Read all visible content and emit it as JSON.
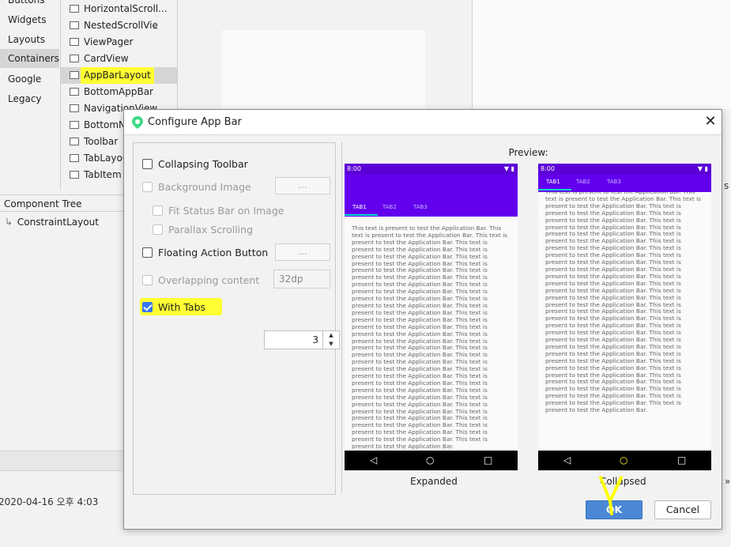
{
  "categories": [
    "Buttons",
    "Widgets",
    "Layouts",
    "Containers",
    "Google",
    "Legacy"
  ],
  "palette_items": [
    "HorizontalScroll...",
    "NestedScrollVie",
    "ViewPager",
    "CardView",
    "AppBarLayout",
    "BottomAppBar",
    "NavigationView",
    "BottomNa",
    "Toolbar",
    "TabLayout",
    "TabItem"
  ],
  "component_tree": {
    "header": "Component Tree",
    "root": "ConstraintLayout"
  },
  "timestamp": "2020-04-16 오후 4:03",
  "side_fragments": [
    "s",
    "»"
  ],
  "dialog": {
    "title": "Configure App Bar",
    "close": "✕",
    "options": {
      "collapsing_toolbar": "Collapsing Toolbar",
      "background_image": "Background Image",
      "fit_status_bar": "Fit Status Bar on Image",
      "parallax": "Parallax Scrolling",
      "fab": "Floating Action Button",
      "overlapping": "Overlapping content",
      "with_tabs": "With Tabs"
    },
    "browse": "...",
    "overlap_value": "32dp",
    "tabs_count": "3",
    "preview_label": "Preview:",
    "status_time": "8:00",
    "tabs": [
      "TAB1",
      "TAB2",
      "TAB3"
    ],
    "body_text": "This text is present to test the Application Bar. This text is present to test the Application Bar. This text is present to test the Application Bar. This text is present to test the Application Bar. This text is present to test the Application Bar. This text is present to test the Application Bar. This text is present to test the Application Bar. This text is present to test the Application Bar. This text is present to test the Application Bar. This text is present to test the Application Bar. This text is present to test the Application Bar. This text is present to test the Application Bar. This text is present to test the Application Bar. This text is present to test the Application Bar. This text is present to test the Application Bar. This text is present to test the Application Bar. This text is present to test the Application Bar. This text is present to test the Application Bar. This text is present to test the Application Bar. This text is present to test the Application Bar. This text is present to test the Application Bar. This text is present to test the Application Bar. This text is present to test the Application Bar. This text is present to test the Application Bar. This text is present to test the Application Bar. This text is present to test the Application Bar. This text is present to test the Application Bar. This text is present to test the Application Bar. This text is present to test the Application Bar. This text is present to test the Application Bar. This text is present to test the Application Bar. This text is present to test the Application Bar.",
    "expanded_caption": "Expanded",
    "collapsed_caption": "Collapsed",
    "ok": "OK",
    "cancel": "Cancel"
  },
  "icons": [
    "android-studio-icon",
    "close-icon",
    "back-nav-icon",
    "home-nav-icon",
    "recents-nav-icon",
    "wifi-icon",
    "battery-icon",
    "tree-node-icon"
  ],
  "colors": {
    "app_bar": "#6200ee",
    "status_bar": "#5b00d6",
    "tab_indicator": "#03dac5",
    "highlight": "#ffff33",
    "ok_button": "#4a88d6"
  }
}
